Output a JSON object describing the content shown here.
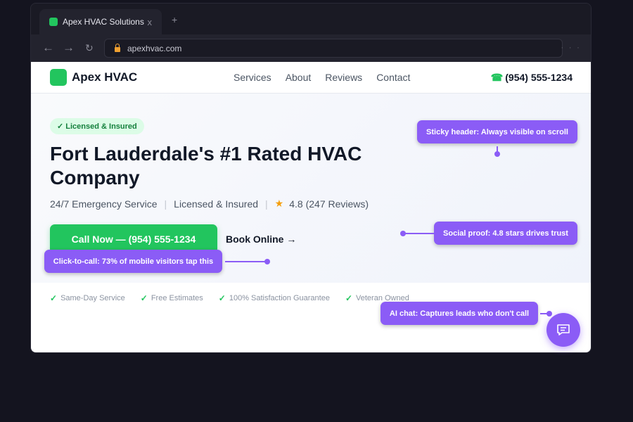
{
  "browser": {
    "tab_title": "Apex HVAC Solutions",
    "tab_close": "x",
    "new_tab": "+",
    "back": "←",
    "forward": "→",
    "reload": "↻",
    "url": "apexhvac.com",
    "more": "· · ·"
  },
  "header": {
    "logo_text": "Apex HVAC",
    "nav": [
      "Services",
      "About",
      "Reviews",
      "Contact"
    ],
    "phone_icon": "☎",
    "phone": "(954) 555-1234"
  },
  "hero": {
    "badge": "✓ Licensed & Insured",
    "headline": "Fort Lauderdale's #1 Rated HVAC Company",
    "sub_items": [
      "24/7 Emergency Service",
      "Licensed & Insured"
    ],
    "separator": "|",
    "star": "★",
    "rating": "4.8 (247 Reviews)",
    "cta": "Call Now — (954) 555-1234",
    "secondary_cta": "Book Online →"
  },
  "trust": {
    "check": "✓",
    "items": [
      "Same-Day Service",
      "Free Estimates",
      "100% Satisfaction Guarantee",
      "Veteran Owned"
    ]
  },
  "annotations": {
    "sticky": "Sticky header: Always visible on scroll",
    "social": "Social proof: 4.8 stars drives trust",
    "click": "Click-to-call: 73% of mobile visitors tap this",
    "chat": "AI chat: Captures leads who don't call"
  },
  "colors": {
    "brand_green": "#22c55e",
    "annotation_purple": "#8b5cf6",
    "star": "#f59e0b"
  }
}
